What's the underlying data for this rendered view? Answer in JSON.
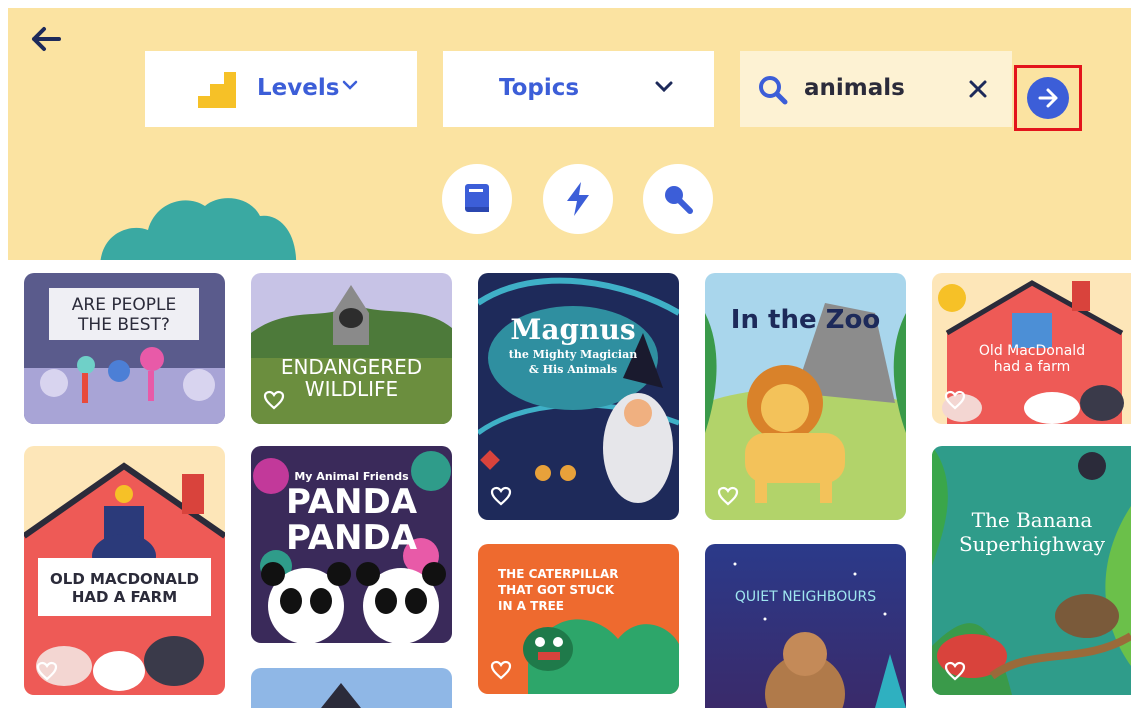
{
  "header": {
    "levels_label": "Levels",
    "topics_label": "Topics",
    "search_value": "animals"
  },
  "icons": {
    "back": "arrow-left-icon",
    "levels": "staircase-icon",
    "chevron": "chevron-down-icon",
    "search": "search-icon",
    "clear": "close-icon",
    "go": "arrow-right-circle-icon",
    "book": "book-icon",
    "bolt": "lightning-icon",
    "magnifier": "magnifier-icon",
    "favorite": "heart-outline-icon"
  },
  "colors": {
    "header_bg": "#fbe3a1",
    "accent_blue": "#3c5ed8",
    "highlight_red": "#e3141b",
    "bush_teal": "#3aa9a2"
  },
  "books": [
    {
      "title": "ARE PEOPLE\nTHE BEST?"
    },
    {
      "title": "ENDANGERED\nWILDLIFE"
    },
    {
      "title": "Magnus",
      "subtitle": "the Mighty Magician\n& His Animals"
    },
    {
      "title": "In the Zoo"
    },
    {
      "title": "Old MacDonald\nhad a farm"
    },
    {
      "title": "OLD MACDONALD\nHAD A FARM"
    },
    {
      "title": "PANDA\nPANDA",
      "subtitle": "My Animal Friends"
    },
    {
      "title": "THE CATERPILLAR\nTHAT GOT STUCK\nIN A TREE"
    },
    {
      "title": "QUIET NEIGHBOURS"
    },
    {
      "title": "The Banana\nSuperhighway"
    }
  ]
}
